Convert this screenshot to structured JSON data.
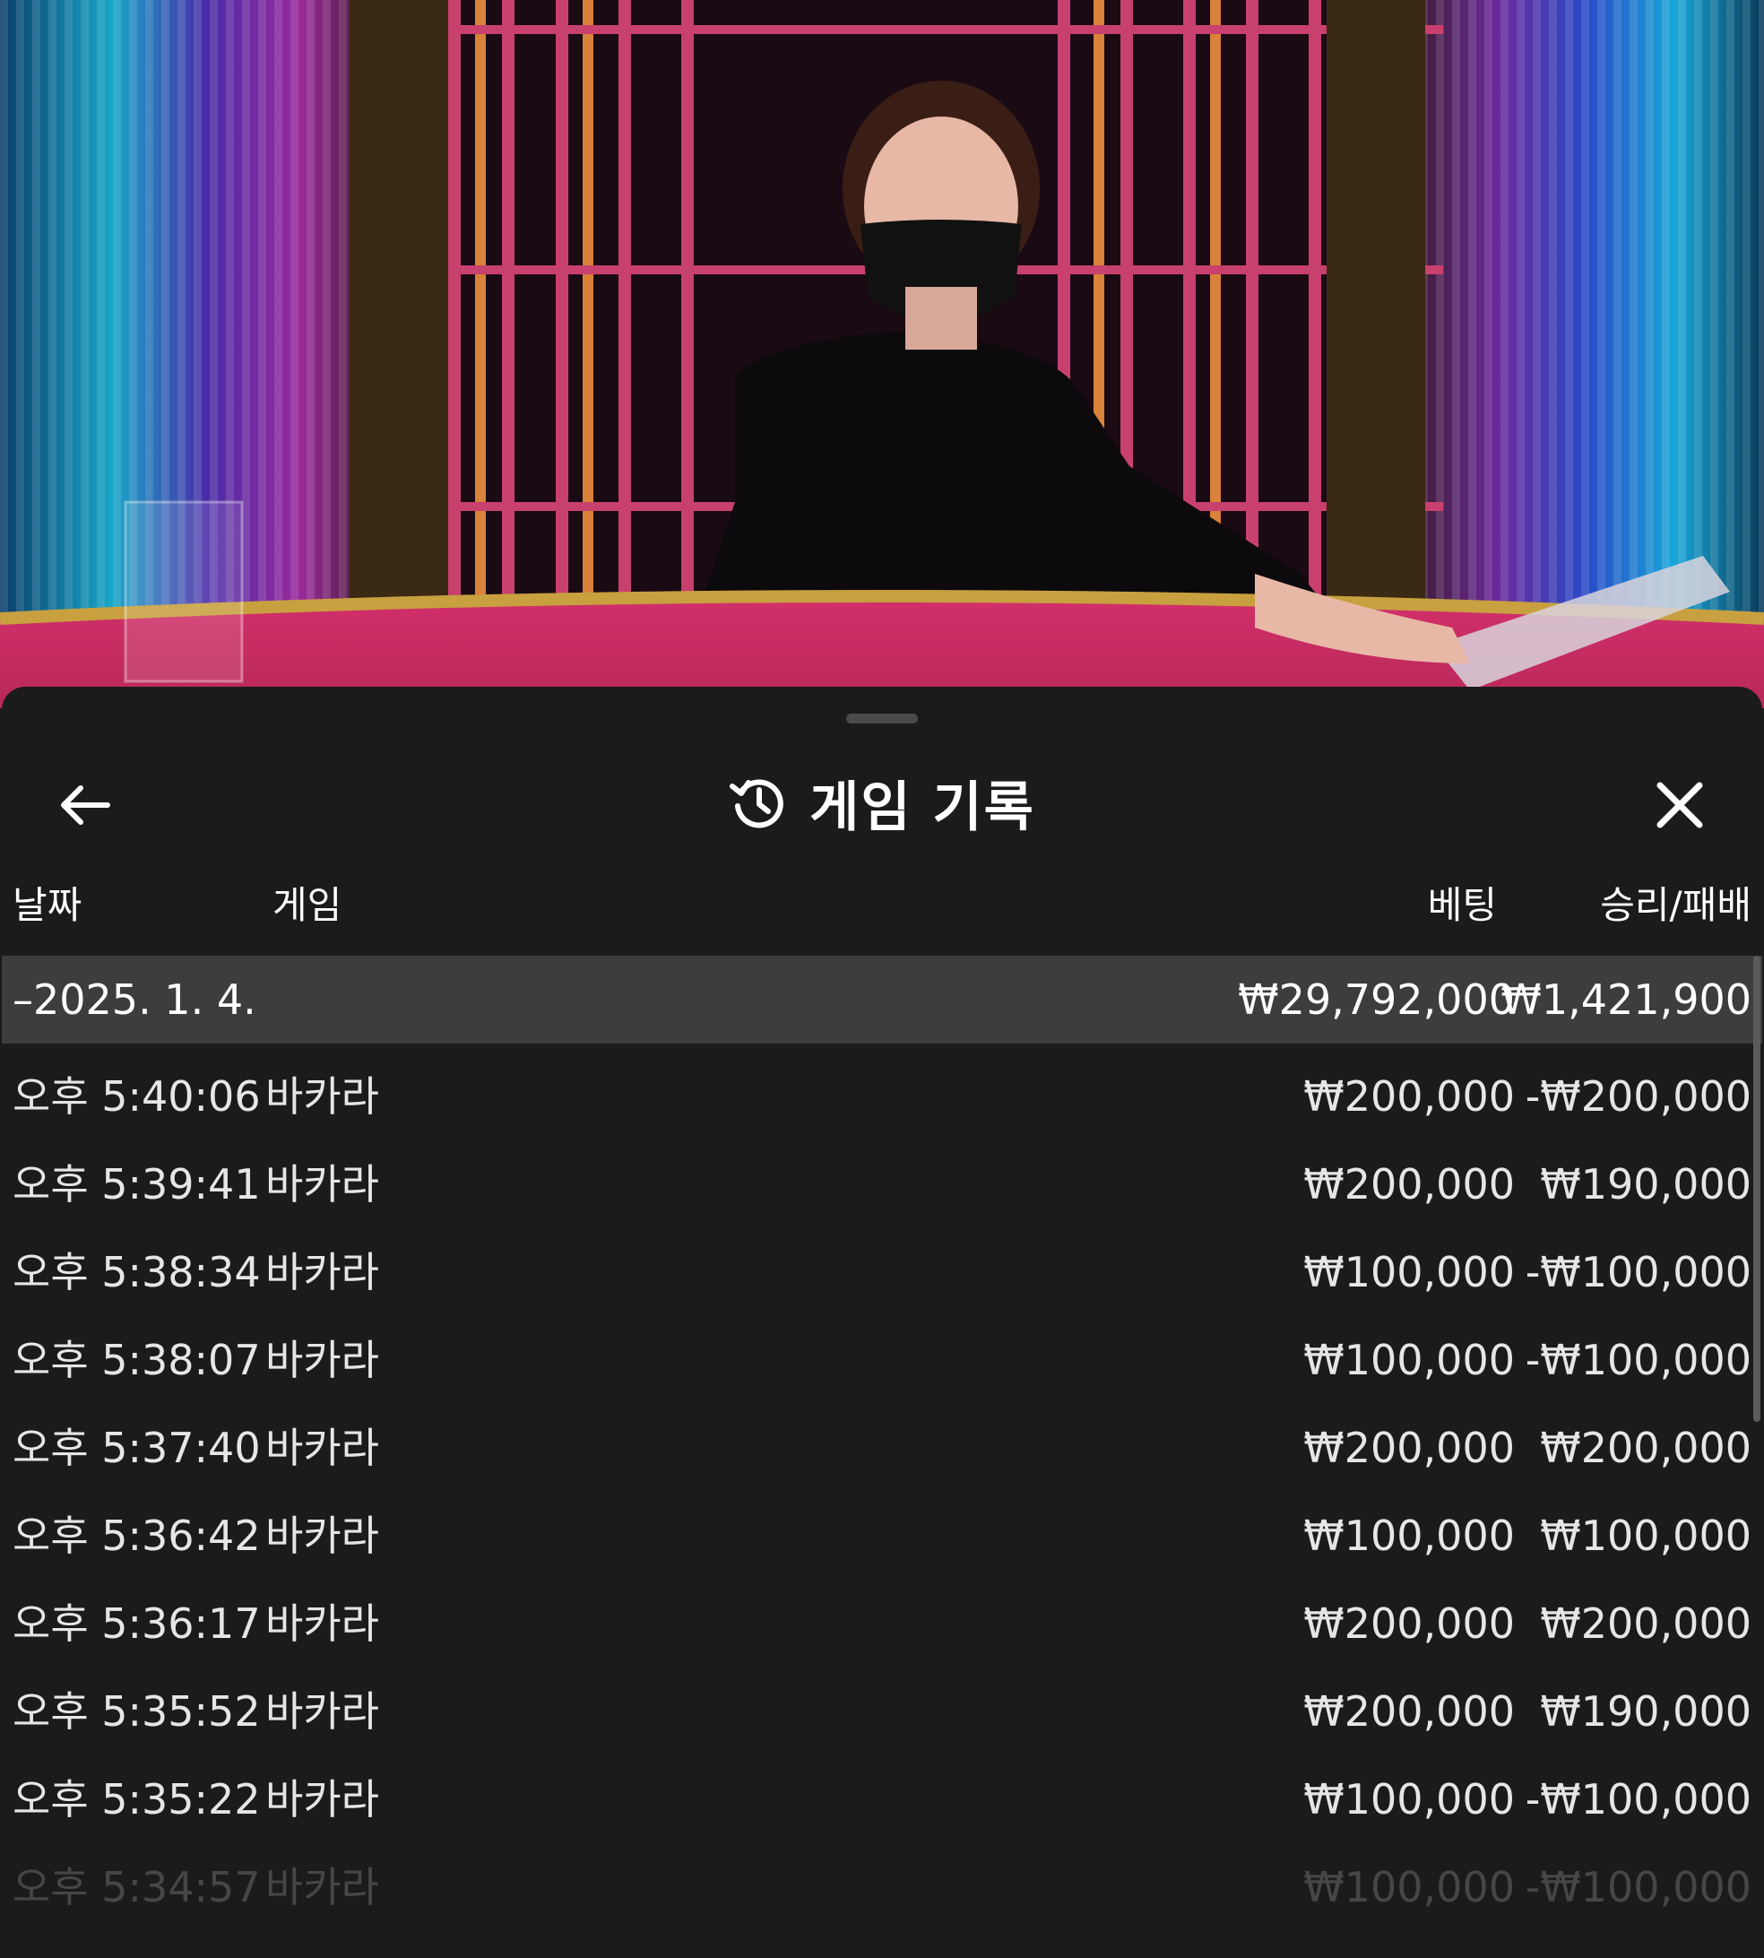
{
  "header": {
    "title": "게임 기록",
    "back_icon": "arrow-left-icon",
    "history_icon": "history-icon",
    "close_icon": "close-icon"
  },
  "columns": {
    "date": "날짜",
    "game": "게임",
    "bet": "베팅",
    "result": "승리/패배"
  },
  "day_summary": {
    "date": "–2025. 1. 4.",
    "bet_total": "₩29,792,000",
    "result_total": "₩1,421,900"
  },
  "rows": [
    {
      "time": "오후 5:40:06",
      "game": "바카라",
      "bet": "₩200,000",
      "result": "-₩200,000"
    },
    {
      "time": "오후 5:39:41",
      "game": "바카라",
      "bet": "₩200,000",
      "result": "₩190,000"
    },
    {
      "time": "오후 5:38:34",
      "game": "바카라",
      "bet": "₩100,000",
      "result": "-₩100,000"
    },
    {
      "time": "오후 5:38:07",
      "game": "바카라",
      "bet": "₩100,000",
      "result": "-₩100,000"
    },
    {
      "time": "오후 5:37:40",
      "game": "바카라",
      "bet": "₩200,000",
      "result": "₩200,000"
    },
    {
      "time": "오후 5:36:42",
      "game": "바카라",
      "bet": "₩100,000",
      "result": "₩100,000"
    },
    {
      "time": "오후 5:36:17",
      "game": "바카라",
      "bet": "₩200,000",
      "result": "₩200,000"
    },
    {
      "time": "오후 5:35:52",
      "game": "바카라",
      "bet": "₩200,000",
      "result": "₩190,000"
    },
    {
      "time": "오후 5:35:22",
      "game": "바카라",
      "bet": "₩100,000",
      "result": "-₩100,000"
    },
    {
      "time": "오후 5:34:57",
      "game": "바카라",
      "bet": "₩100,000",
      "result": "-₩100,000"
    }
  ]
}
